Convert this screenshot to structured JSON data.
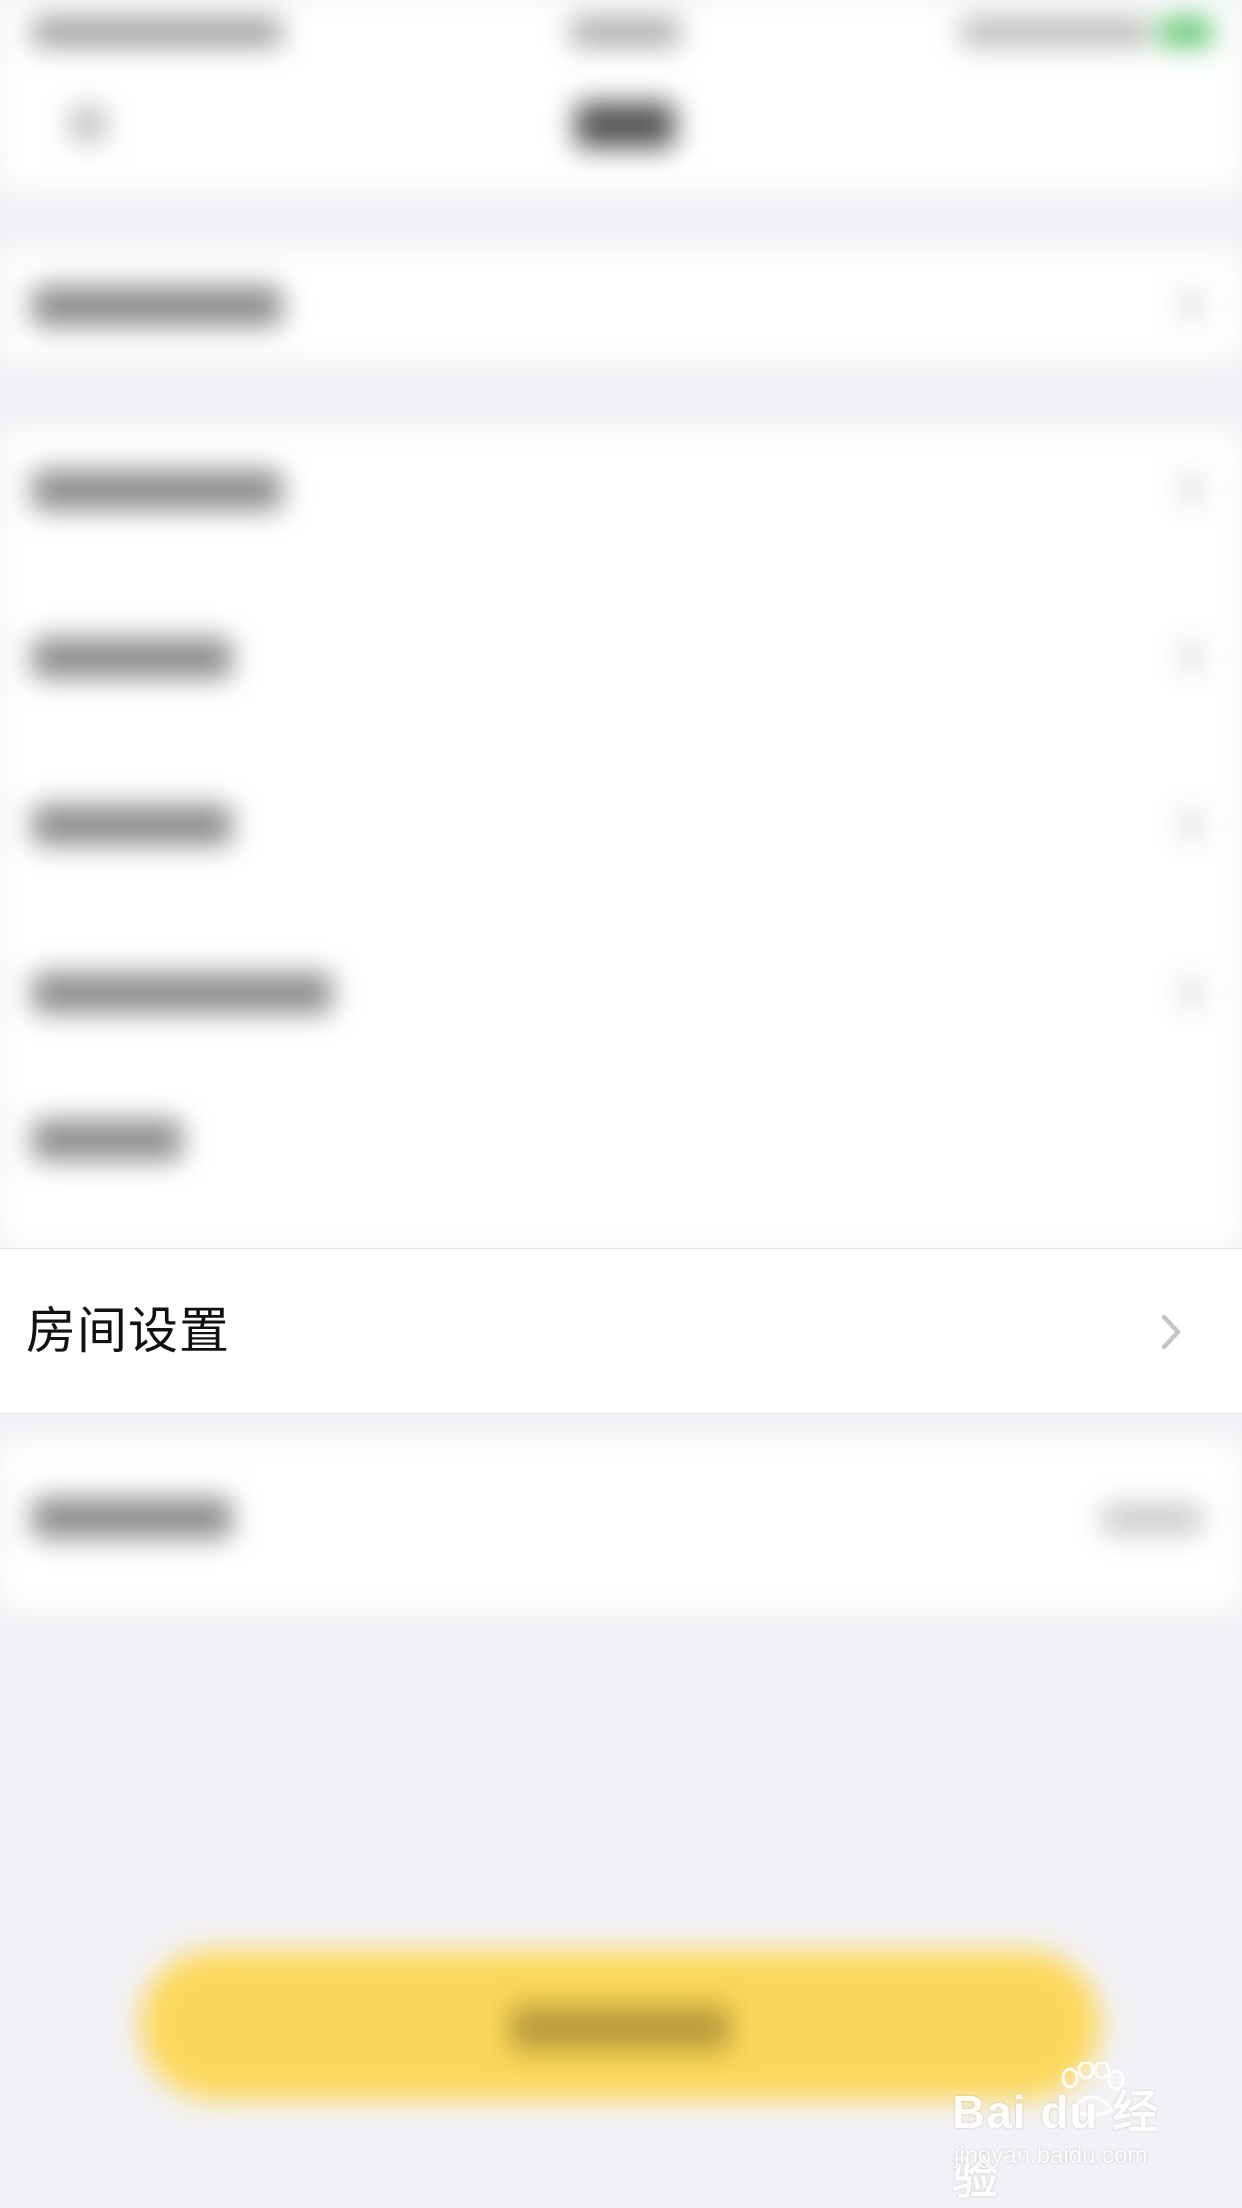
{
  "focus_row": {
    "label": "房间设置"
  },
  "icons": {
    "row_chevron": "chevron-right-icon"
  },
  "watermark": {
    "logo_text": "Bai du 经验",
    "url": "jingyan.baidu.com"
  },
  "colors": {
    "accent_button": "#fdd75a",
    "page_background": "#f2f2f6",
    "chevron": "#c4c4c9"
  }
}
